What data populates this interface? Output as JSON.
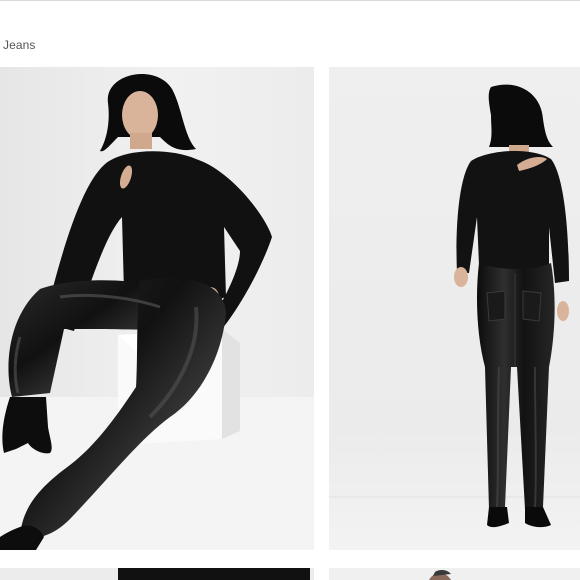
{
  "breadcrumb": {
    "label": "Jeans"
  },
  "gallery": {
    "images": [
      {
        "name": "product-photo-front"
      },
      {
        "name": "product-photo-back"
      },
      {
        "name": "product-photo-3"
      },
      {
        "name": "product-photo-4"
      }
    ]
  },
  "colors": {
    "background": "#ffffff",
    "studio_backdrop": "#eeeeee",
    "garment": "#111111",
    "leather_highlight": "#4a4a4a",
    "skin": "#d9b49a",
    "breadcrumb_text": "#555555"
  }
}
